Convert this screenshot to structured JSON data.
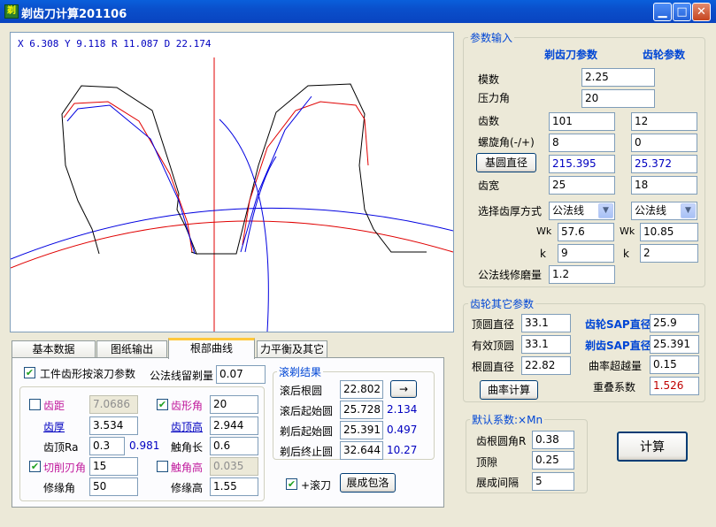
{
  "window": {
    "title": "剃齿刀计算201106"
  },
  "plot": {
    "coord_text": "X 6.308  Y 9.118   R 11.087 D 22.174"
  },
  "input_group": {
    "title": "参数输入",
    "col_shaver": "剃齿刀参数",
    "col_gear": "齿轮参数",
    "rows": {
      "module": {
        "label": "模数",
        "value": "2.25"
      },
      "pressure": {
        "label": "压力角",
        "value": "20"
      },
      "teeth": {
        "label": "齿数",
        "shaver": "101",
        "gear": "12"
      },
      "helix": {
        "label": "螺旋角(-/+)",
        "shaver": "8",
        "gear": "0"
      },
      "base": {
        "label": "基圆直径",
        "shaver": "215.395",
        "gear": "25.372"
      },
      "width": {
        "label": "齿宽",
        "shaver": "25",
        "gear": "18"
      },
      "method": {
        "label": "选择齿厚方式",
        "shaver": "公法线",
        "gear": "公法线"
      },
      "wk": {
        "label": "Wk",
        "shaver": "57.6",
        "gear": "10.85"
      },
      "k": {
        "label": "k",
        "shaver": "9",
        "gear": "2"
      },
      "grind": {
        "label": "公法线修磨量",
        "value": "1.2"
      }
    }
  },
  "gear_other": {
    "title": "齿轮其它参数",
    "tip": {
      "label": "顶圆直径",
      "value": "33.1"
    },
    "eff_tip": {
      "label": "有效顶圆",
      "value": "33.1"
    },
    "root": {
      "label": "根圆直径",
      "value": "22.82"
    },
    "curv_button": "曲率计算",
    "gear_sap": {
      "label": "齿轮SAP直径",
      "value": "25.9"
    },
    "shaver_sap": {
      "label": "剃齿SAP直径",
      "value": "25.391"
    },
    "over_curv": {
      "label": "曲率超越量",
      "value": "0.15"
    },
    "overlap": {
      "label": "重叠系数",
      "value": "1.526"
    }
  },
  "defaults": {
    "title": "默认系数:×Mn",
    "root_fillet": {
      "label": "齿根圆角R",
      "value": "0.38"
    },
    "clearance": {
      "label": "顶隙",
      "value": "0.25"
    },
    "spacing": {
      "label": "展成间隔",
      "value": "5"
    }
  },
  "calc_button": "计算",
  "tabs": [
    "基本数据",
    "图纸输出",
    "根部曲线",
    "力平衡及其它"
  ],
  "tab_panel": {
    "workpiece_check": "✔",
    "workpiece_label": "工件齿形按滚刀参数",
    "grind_stock_label": "公法线留剃量",
    "grind_stock_value": "0.07",
    "pitch": {
      "label": "齿距",
      "value": "7.0686"
    },
    "thickness": {
      "label": "齿厚",
      "value": "3.534"
    },
    "tip_ra": {
      "label": "齿顶Ra",
      "value": "0.3",
      "side": "0.981"
    },
    "cut_edge": {
      "label": "切削刃角",
      "value": "15",
      "check": "✔"
    },
    "trim_angle": {
      "label": "修缘角",
      "value": "50"
    },
    "profile_angle": {
      "label": "齿形角",
      "value": "20",
      "check": "✔"
    },
    "addendum": {
      "label": "齿顶高",
      "value": "2.944"
    },
    "horn_len": {
      "label": "触角长",
      "value": "0.6"
    },
    "horn_height": {
      "label": "触角高",
      "value": "0.035"
    },
    "trim_height": {
      "label": "修缘高",
      "value": "1.55"
    },
    "result_title": "滚剃结果",
    "after_root": {
      "label": "滚后根圆",
      "value": "22.802"
    },
    "arrow_button": "→",
    "after_start": {
      "label": "滚后起始圆",
      "value": "25.728",
      "side": "2.134"
    },
    "shave_start": {
      "label": "剃后起始圆",
      "value": "25.391",
      "side": "0.497"
    },
    "shave_end": {
      "label": "剃后终止圆",
      "value": "32.644",
      "side": "10.27"
    },
    "hob_check": "✔",
    "hob_label": "+滚刀",
    "envelope_button": "展成包洛"
  }
}
